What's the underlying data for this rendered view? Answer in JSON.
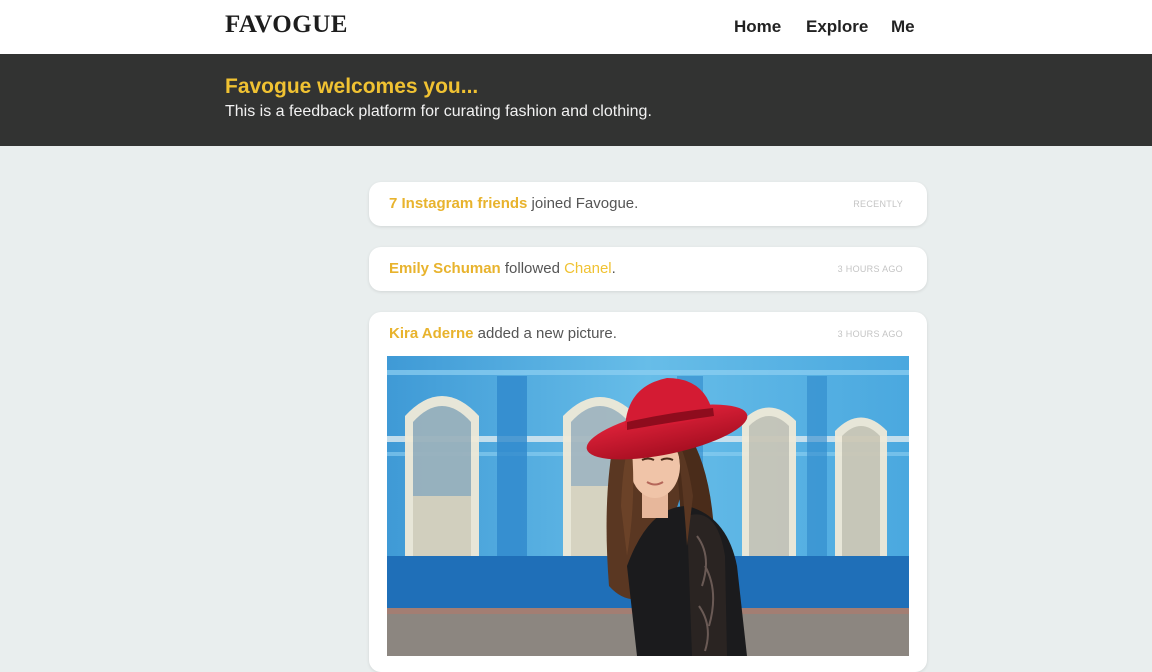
{
  "header": {
    "logo": "FAVOGUE",
    "nav": [
      {
        "label": "Home"
      },
      {
        "label": "Explore"
      },
      {
        "label": "Me"
      }
    ]
  },
  "hero": {
    "title": "Favogue welcomes you...",
    "subtitle": "This is a feedback platform for curating fashion and clothing."
  },
  "feed": [
    {
      "actor": "7 Instagram friends",
      "action": " joined Favogue.",
      "time": "RECENTLY"
    },
    {
      "actor": "Emily Schuman",
      "action": " followed ",
      "target": "Chanel",
      "suffix": ".",
      "time": "3 HOURS AGO"
    },
    {
      "actor": "Kira Aderne",
      "action": " added a new picture.",
      "time": "3 HOURS AGO"
    }
  ],
  "colors": {
    "accent": "#f0c232",
    "hero_bg": "#323332",
    "page_bg": "#e9eeee"
  }
}
